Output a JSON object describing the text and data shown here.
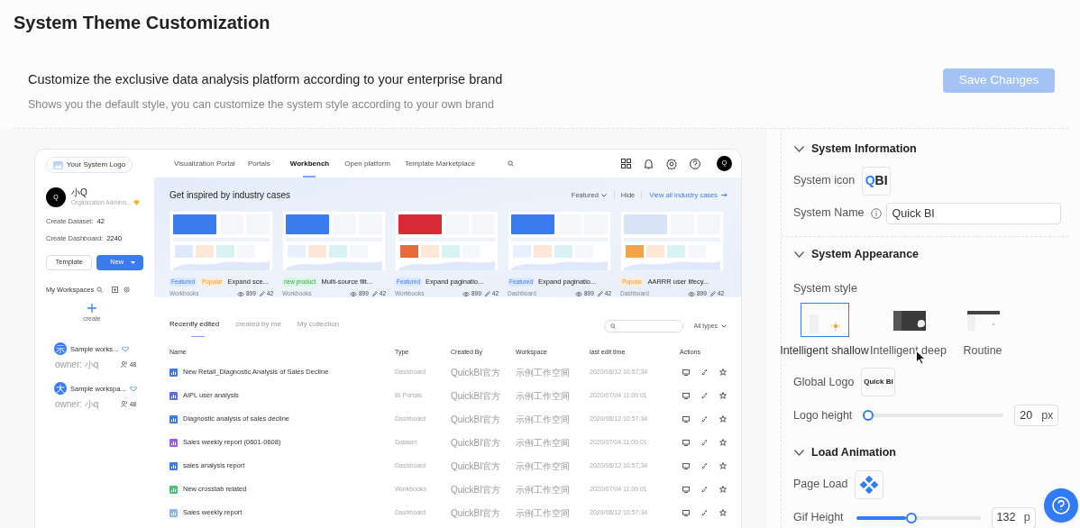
{
  "page": {
    "title": "System Theme Customization",
    "subtitle": "Customize the exclusive data analysis platform according to your enterprise brand",
    "description": "Shows you the default style, you can customize the system style according to your own brand",
    "save_button": {
      "label": "Save Changes",
      "disabled": true
    }
  },
  "preview": {
    "logo_label": "Your System Logo",
    "user": {
      "avatar": "Q",
      "name": "小Q",
      "role": "Organization Adminis..."
    },
    "stats": [
      {
        "label": "Create Dataset:",
        "value": "42"
      },
      {
        "label": "Create Dashboard:",
        "value": "2240"
      }
    ],
    "template_button": "Template",
    "new_button": "New",
    "workspaces": {
      "title": "My Workspaces",
      "create": "create",
      "items": [
        {
          "icon": "示",
          "name": "Sample works...",
          "owner": "owner: 小q",
          "members": "48"
        },
        {
          "icon": "大",
          "name": "Sample workspa...",
          "owner": "owner: 小q",
          "members": "48"
        }
      ]
    },
    "nav": [
      {
        "label": "Visualization Portal",
        "selected": false
      },
      {
        "label": "Portals",
        "selected": false
      },
      {
        "label": "Workbench",
        "selected": true
      },
      {
        "label": "Open platform",
        "selected": false
      },
      {
        "label": "Template Marketplace",
        "selected": false
      }
    ],
    "nav_avatar": "Q",
    "banner": {
      "title": "Get inspired by industry cases",
      "sort": "Featured",
      "hide": "Hide",
      "link": "View all industry cases",
      "cases": [
        {
          "kind": "picture",
          "tags": [
            {
              "label": "Featured",
              "kind": "featured"
            },
            {
              "label": "Popular",
              "kind": "popular"
            }
          ],
          "title": "Expand sce...",
          "category": "Workbooks",
          "views": "899",
          "edits": "42"
        },
        {
          "kind": "picture",
          "tags": [
            {
              "label": "new product",
              "kind": "new"
            }
          ],
          "title": "Multi-source filt...",
          "category": "Workbooks",
          "views": "899",
          "edits": "42"
        },
        {
          "kind": "picture",
          "tags": [
            {
              "label": "Featured",
              "kind": "featured"
            }
          ],
          "title": "Expand paginatio...",
          "category": "Workbooks",
          "views": "899",
          "edits": "42"
        },
        {
          "kind": "picture",
          "tags": [
            {
              "label": "Featured",
              "kind": "featured"
            }
          ],
          "title": "Expand paginatio...",
          "category": "Dashboard",
          "views": "899",
          "edits": "42"
        },
        {
          "kind": "picture",
          "tags": [
            {
              "label": "Popular",
              "kind": "popular"
            }
          ],
          "title": "AARRR user lifecy...",
          "category": "Dashboard",
          "views": "899",
          "edits": "42"
        }
      ]
    },
    "list_tabs": [
      {
        "label": "Recently edited",
        "selected": true
      },
      {
        "label": "created by me",
        "selected": false
      },
      {
        "label": "My collection",
        "selected": false
      }
    ],
    "type_filter": "All types",
    "table": {
      "columns": [
        "Name",
        "Type",
        "Created By",
        "Workspace",
        "last edit time",
        "Actions"
      ],
      "rows": [
        {
          "name": "New Retail_Diagnostic Analysis of Sales Decline",
          "color": "#3b7cf0",
          "type": "Dashboard",
          "created_by": "QuickBI官方",
          "workspace": "示例工作空间",
          "time": "2020/06/12 10:57:34"
        },
        {
          "name": "AIPL user analysis",
          "color": "#5a6cf0",
          "type": "BI Portals",
          "created_by": "QuickBI官方",
          "workspace": "示例工作空间",
          "time": "2020/07/04 11:09:01"
        },
        {
          "name": "Diagnostic analysis of sales decline",
          "color": "#3b7cf0",
          "type": "Dashboard",
          "created_by": "QuickBI官方",
          "workspace": "示例工作空间",
          "time": "2020/06/12 10:57:34"
        },
        {
          "name": "Sales weekly report (0601-0608)",
          "color": "#9b5cf0",
          "type": "Dataset",
          "created_by": "QuickBI官方",
          "workspace": "示例工作空间",
          "time": "2020/07/04 11:09:01"
        },
        {
          "name": "sales analysis report",
          "color": "#3b7cf0",
          "type": "Dashboard",
          "created_by": "QuickBI官方",
          "workspace": "示例工作空间",
          "time": "2020/06/12 10:57:34"
        },
        {
          "name": "New crosstab related",
          "color": "#4cc27a",
          "type": "Workbooks",
          "created_by": "QuickBI官方",
          "workspace": "示例工作空间",
          "time": "2020/07/04 11:09:01"
        },
        {
          "name": "Sales weekly report",
          "color": "#8fb4f5",
          "type": "Dashboard",
          "created_by": "QuickBI官方",
          "workspace": "示例工作空间",
          "time": "2020/06/12 10:57:34"
        }
      ]
    }
  },
  "settings": {
    "system_information": {
      "title": "System Information",
      "expanded": true,
      "icon_label": "System icon",
      "icon_text": "QBI",
      "name_label": "System Name",
      "name_value": "Quick BI"
    },
    "system_appearance": {
      "title": "System Appearance",
      "expanded": true,
      "style_label": "System style",
      "styles": [
        {
          "label": "Intelligent shallow",
          "kind": "light",
          "selected": true
        },
        {
          "label": "Intelligent deep",
          "kind": "dark",
          "selected": false
        },
        {
          "label": "Routine",
          "kind": "classic",
          "selected": false
        }
      ],
      "logo_label": "Global Logo",
      "logo_text": "Quick BI",
      "logo_height": {
        "label": "Logo height",
        "level": 0,
        "value": "20",
        "unit": "px"
      }
    },
    "load_animation": {
      "title": "Load Animation",
      "expanded": true,
      "page_load_label": "Page Load",
      "gif_height": {
        "label": "Gif Height",
        "level": 0.4,
        "value": "132",
        "unit": "p"
      }
    }
  }
}
